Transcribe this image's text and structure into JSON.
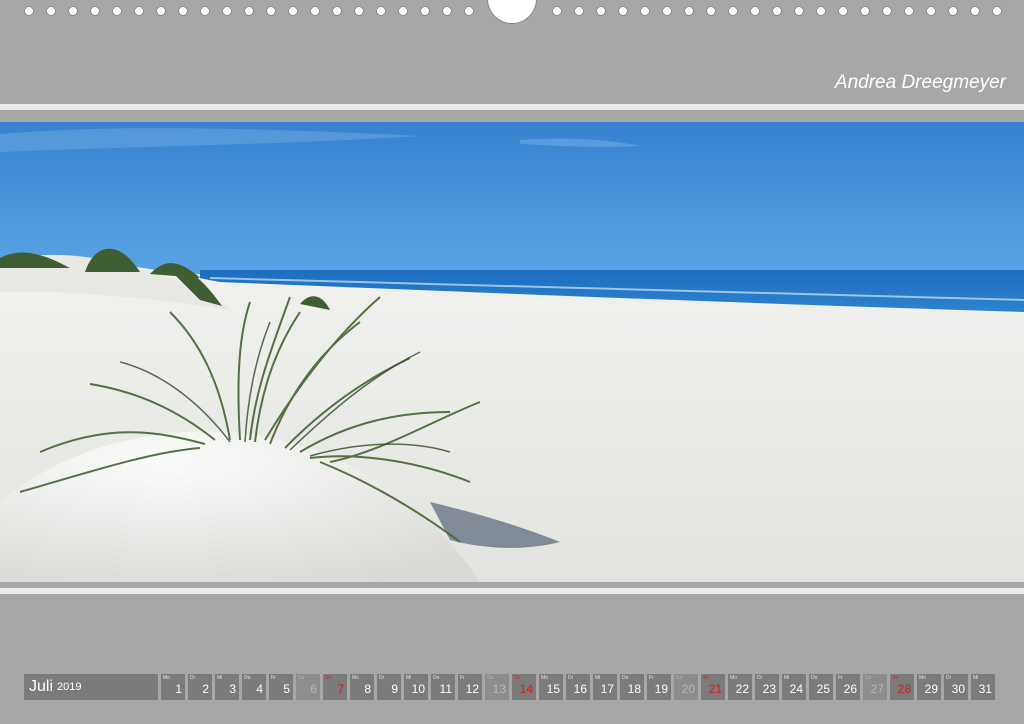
{
  "author": "Andrea Dreegmeyer",
  "photo": {
    "subject": "beach-dune-photo",
    "colors": {
      "sky": "#3d8dd6",
      "sea": "#1f73c4",
      "sand": "#ededeb",
      "grass": "#4b6b3a"
    }
  },
  "calendar": {
    "month": "Juli",
    "year": "2019",
    "days": [
      {
        "wd": "Mo",
        "num": "1",
        "type": "weekday"
      },
      {
        "wd": "Di",
        "num": "2",
        "type": "weekday"
      },
      {
        "wd": "Mi",
        "num": "3",
        "type": "weekday"
      },
      {
        "wd": "Do",
        "num": "4",
        "type": "weekday"
      },
      {
        "wd": "Fr",
        "num": "5",
        "type": "weekday"
      },
      {
        "wd": "Sa",
        "num": "6",
        "type": "saturday"
      },
      {
        "wd": "So",
        "num": "7",
        "type": "sunday"
      },
      {
        "wd": "Mo",
        "num": "8",
        "type": "weekday"
      },
      {
        "wd": "Di",
        "num": "9",
        "type": "weekday"
      },
      {
        "wd": "Mi",
        "num": "10",
        "type": "weekday"
      },
      {
        "wd": "Do",
        "num": "11",
        "type": "weekday"
      },
      {
        "wd": "Fr",
        "num": "12",
        "type": "weekday"
      },
      {
        "wd": "Sa",
        "num": "13",
        "type": "saturday"
      },
      {
        "wd": "So",
        "num": "14",
        "type": "sunday"
      },
      {
        "wd": "Mo",
        "num": "15",
        "type": "weekday"
      },
      {
        "wd": "Di",
        "num": "16",
        "type": "weekday"
      },
      {
        "wd": "Mi",
        "num": "17",
        "type": "weekday"
      },
      {
        "wd": "Do",
        "num": "18",
        "type": "weekday"
      },
      {
        "wd": "Fr",
        "num": "19",
        "type": "weekday"
      },
      {
        "wd": "Sa",
        "num": "20",
        "type": "saturday"
      },
      {
        "wd": "So",
        "num": "21",
        "type": "sunday"
      },
      {
        "wd": "Mo",
        "num": "22",
        "type": "weekday"
      },
      {
        "wd": "Di",
        "num": "23",
        "type": "weekday"
      },
      {
        "wd": "Mi",
        "num": "24",
        "type": "weekday"
      },
      {
        "wd": "Do",
        "num": "25",
        "type": "weekday"
      },
      {
        "wd": "Fr",
        "num": "26",
        "type": "weekday"
      },
      {
        "wd": "Sa",
        "num": "27",
        "type": "saturday"
      },
      {
        "wd": "So",
        "num": "28",
        "type": "sunday"
      },
      {
        "wd": "Mo",
        "num": "29",
        "type": "weekday"
      },
      {
        "wd": "Di",
        "num": "30",
        "type": "weekday"
      },
      {
        "wd": "Mi",
        "num": "31",
        "type": "weekday"
      }
    ]
  }
}
